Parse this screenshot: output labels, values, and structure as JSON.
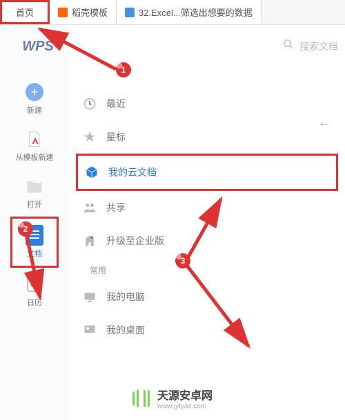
{
  "tabs": {
    "home": "首页",
    "docer": "稻壳模板",
    "excel": "32.Excel...筛选出想要的数据"
  },
  "logo": "WPS",
  "search": {
    "placeholder": "搜索文档"
  },
  "leftNav": {
    "new": "新建",
    "template": "从模板新建",
    "open": "打开",
    "docs": "文档",
    "calendar": "日历",
    "calNum": "31"
  },
  "list": {
    "recent": "最近",
    "star": "星标",
    "cloud": "我的云文档",
    "share": "共享",
    "enterprise": "升级至企业版",
    "section": "常用",
    "computer": "我的电脑",
    "desktop": "我的桌面"
  },
  "markers": {
    "m1": "1",
    "m2": "2",
    "m3": "3"
  },
  "watermark": {
    "name": "天源安卓网",
    "url": "www.jytyaz.com"
  }
}
